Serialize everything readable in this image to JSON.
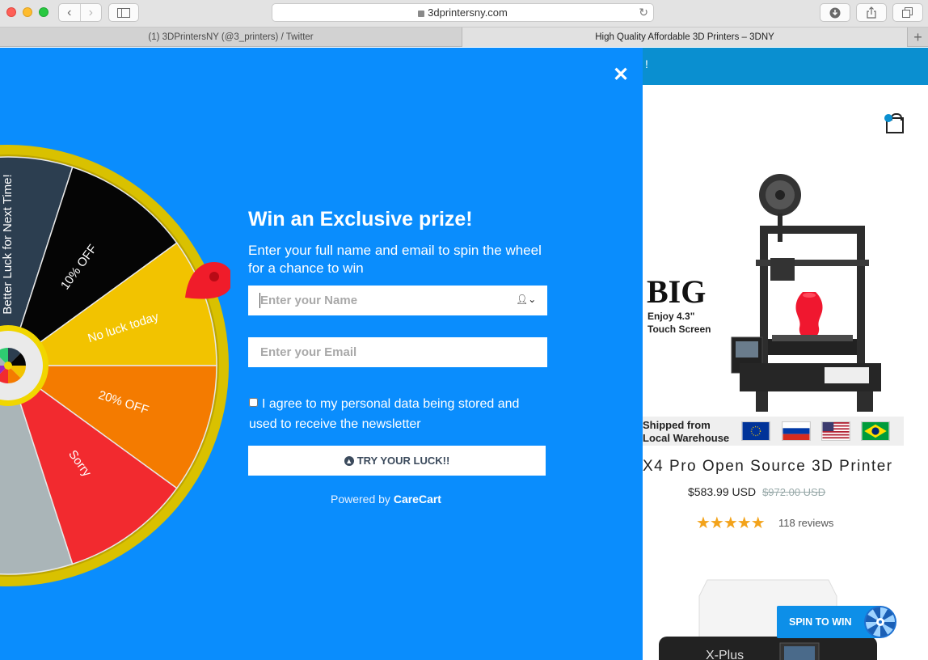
{
  "browser": {
    "url": "3dprintersny.com",
    "tabs": [
      {
        "title": "(1) 3DPrintersNY (@3_printers) / Twitter"
      },
      {
        "title": "High Quality Affordable 3D Printers – 3DNY"
      }
    ],
    "new_tab": "+"
  },
  "popup": {
    "title": "Win an Exclusive prize!",
    "subtitle": "Enter your full name and email to spin the wheel for a chance to win",
    "name_placeholder": "Enter your Name",
    "email_placeholder": "Enter your Email",
    "consent_text": "I agree to my personal data being stored and used to receive the newsletter",
    "button_label": "TRY YOUR LUCK!!",
    "powered_prefix": "Powered by",
    "powered_brand": "CareCart",
    "wheel_segments": [
      {
        "label": "Better Luck for Next Time!",
        "color": "#2c3e50"
      },
      {
        "label": "10% OFF",
        "color": "#050505"
      },
      {
        "label": "No luck today",
        "color": "#f2c300"
      },
      {
        "label": "20% OFF",
        "color": "#f47b00"
      },
      {
        "label": "Sorry",
        "color": "#f22a2f"
      }
    ],
    "accent_color": "#0a8dfd"
  },
  "store": {
    "announcement": "!",
    "banner": {
      "headline": "BIG",
      "feature": "Enjoy 4.3\" Touch Screen",
      "shipping": "Shipped from Local Warehouse"
    },
    "product_title": "X4 Pro Open Source 3D Printer",
    "price": "$583.99 USD",
    "old_price": "$972.00 USD",
    "stars": "★★★★★",
    "reviews": "118 reviews",
    "second_product_label": "X-Plus",
    "spin_button": "SPIN TO WIN"
  }
}
